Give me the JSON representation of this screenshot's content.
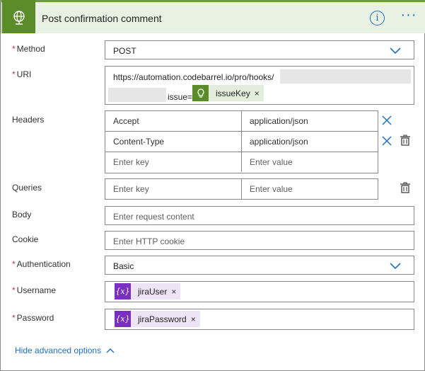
{
  "header": {
    "title": "Post confirmation comment",
    "icon": "globe-icon",
    "info_label": "i",
    "more_label": "···",
    "accent": "#5b8c2a"
  },
  "method": {
    "label": "Method",
    "required": "*",
    "value": "POST"
  },
  "uri": {
    "label": "URI",
    "required": "*",
    "value_prefix": "https://automation.codebarrel.io/pro/hooks/",
    "query_prefix": "issue=",
    "token": "issueKey"
  },
  "headers": {
    "label": "Headers",
    "rows": [
      {
        "key": "Accept",
        "value": "application/json"
      },
      {
        "key": "Content-Type",
        "value": "application/json"
      }
    ],
    "key_placeholder": "Enter key",
    "value_placeholder": "Enter value"
  },
  "queries": {
    "label": "Queries",
    "key_placeholder": "Enter key",
    "value_placeholder": "Enter value"
  },
  "body": {
    "label": "Body",
    "placeholder": "Enter request content"
  },
  "cookie": {
    "label": "Cookie",
    "placeholder": "Enter HTTP cookie"
  },
  "authentication": {
    "label": "Authentication",
    "required": "*",
    "value": "Basic"
  },
  "username": {
    "label": "Username",
    "required": "*",
    "token": "jiraUser"
  },
  "password": {
    "label": "Password",
    "required": "*",
    "token": "jiraPassword"
  },
  "advanced": {
    "label": "Hide advanced options"
  },
  "token_remove": "×",
  "variable_icon_text": "{x}"
}
